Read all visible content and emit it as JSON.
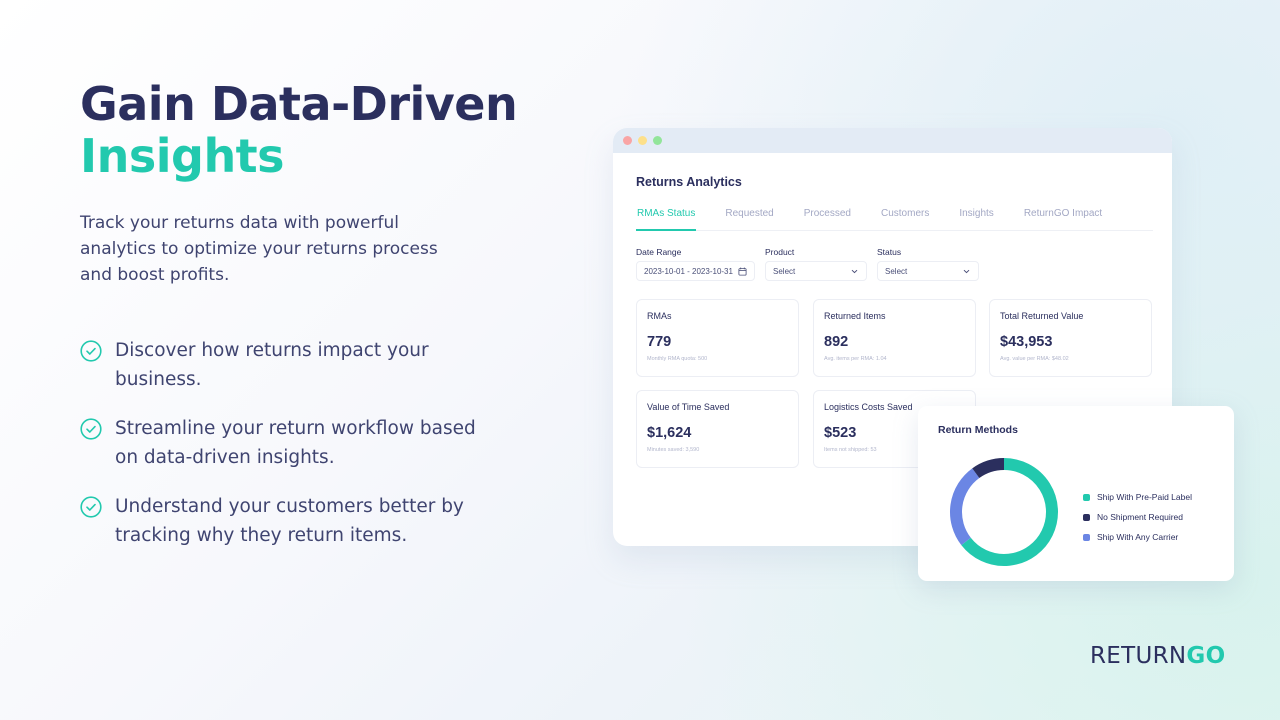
{
  "colors": {
    "navy": "#2b2f5e",
    "teal": "#22c9ae",
    "blue": "#6b86e4",
    "muted": "#a3a8c4"
  },
  "hero": {
    "title_line1": "Gain Data-Driven",
    "title_line2": "Insights",
    "description": "Track your returns data with powerful analytics to optimize your returns process and boost profits."
  },
  "bullets": [
    {
      "icon": "check-circle-icon",
      "text": "Discover how returns impact your business."
    },
    {
      "icon": "check-circle-icon",
      "text": "Streamline your return workflow based on data-driven insights."
    },
    {
      "icon": "check-circle-icon",
      "text": "Understand your customers better by tracking why they return items."
    }
  ],
  "window": {
    "title": "Returns Analytics",
    "tabs": [
      {
        "label": "RMAs Status",
        "active": true
      },
      {
        "label": "Requested",
        "active": false
      },
      {
        "label": "Processed",
        "active": false
      },
      {
        "label": "Customers",
        "active": false
      },
      {
        "label": "Insights",
        "active": false
      },
      {
        "label": "ReturnGO Impact",
        "active": false
      }
    ],
    "filters": {
      "date_range": {
        "label": "Date Range",
        "value": "2023-10-01 - 2023-10-31",
        "icon": "calendar-icon"
      },
      "product": {
        "label": "Product",
        "value": "Select",
        "icon": "chevron-down-icon"
      },
      "status": {
        "label": "Status",
        "value": "Select",
        "icon": "chevron-down-icon"
      }
    },
    "cards": [
      {
        "title": "RMAs",
        "value": "779",
        "sub": "Monthly RMA quota: 500"
      },
      {
        "title": "Returned Items",
        "value": "892",
        "sub": "Avg. items per RMA: 1.04"
      },
      {
        "title": "Total Returned Value",
        "value": "$43,953",
        "sub": "Avg. value per RMA: $48.02"
      },
      {
        "title": "Value of Time Saved",
        "value": "$1,624",
        "sub": "Minutes saved: 3,590"
      },
      {
        "title": "Logistics Costs Saved",
        "value": "$523",
        "sub": "Items not shipped: 53"
      }
    ]
  },
  "return_methods": {
    "title": "Return Methods"
  },
  "chart_data": {
    "type": "pie",
    "title": "Return Methods",
    "donut": true,
    "legend_position": "right",
    "categories": [
      "Ship With Pre-Paid Label",
      "Ship With Any Carrier",
      "No Shipment Required"
    ],
    "values": [
      64.5,
      25.5,
      10
    ],
    "unit": "percent (estimated)",
    "colors": [
      "#22c9ae",
      "#6b86e4",
      "#2b2f5e"
    ],
    "legend_order": [
      "Ship With Pre-Paid Label",
      "No Shipment Required",
      "Ship With Any Carrier"
    ]
  },
  "logo": {
    "part1": "RETURN",
    "part2": "GO"
  }
}
